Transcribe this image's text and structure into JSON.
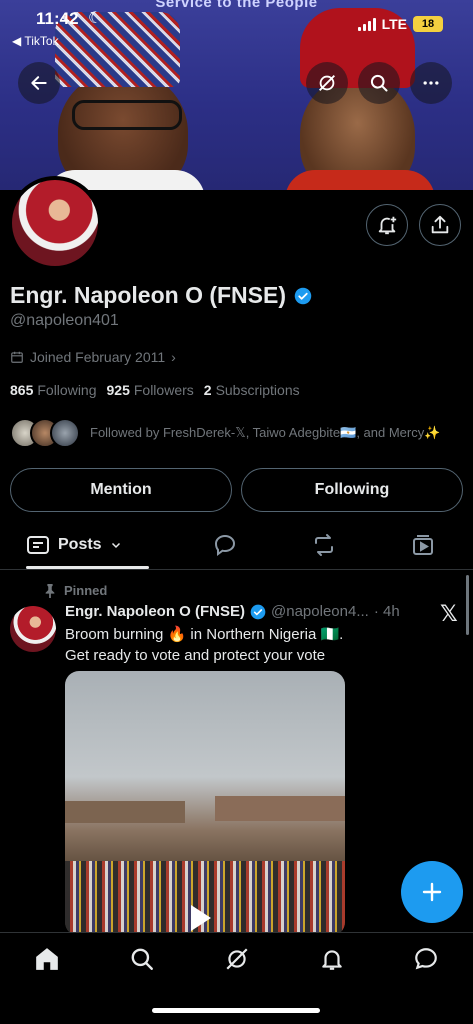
{
  "status_bar": {
    "time": "11:42",
    "back_app": "◀ TikTok",
    "network": "LTE",
    "battery": "18"
  },
  "banner": {
    "text": "Service to the People"
  },
  "profile": {
    "display_name": "Engr. Napoleon O (FNSE)",
    "handle": "@napoleon401",
    "joined": "Joined February 2011",
    "following_count": "865",
    "following_label": "Following",
    "followers_count": "925",
    "followers_label": "Followers",
    "subscriptions_count": "2",
    "subscriptions_label": "Subscriptions",
    "followed_by": "Followed by FreshDerek-𝕏, Taiwo Adegbite🇦🇷, and Mercy✨",
    "verified_color": "#1d9bf0"
  },
  "actions": {
    "mention_label": "Mention",
    "following_label": "Following"
  },
  "tabs": {
    "posts_label": "Posts"
  },
  "post": {
    "pinned_label": "Pinned",
    "author_name": "Engr. Napoleon O (FNSE)",
    "author_handle": "@napoleon4...",
    "time": "· 4h",
    "text_line1": "Broom burning 🔥 in Northern Nigeria 🇳🇬.",
    "text_line2": "Get ready to vote and protect your vote"
  },
  "icons": {
    "back": "arrow-left-icon",
    "grok": "grok-icon",
    "search": "search-icon",
    "more": "more-icon",
    "notify": "bell-plus-icon",
    "share": "share-icon",
    "calendar": "calendar-icon",
    "fab": "plus-icon"
  },
  "colors": {
    "accent": "#1d9bf0",
    "background": "#000000",
    "muted_text": "#71767b"
  }
}
